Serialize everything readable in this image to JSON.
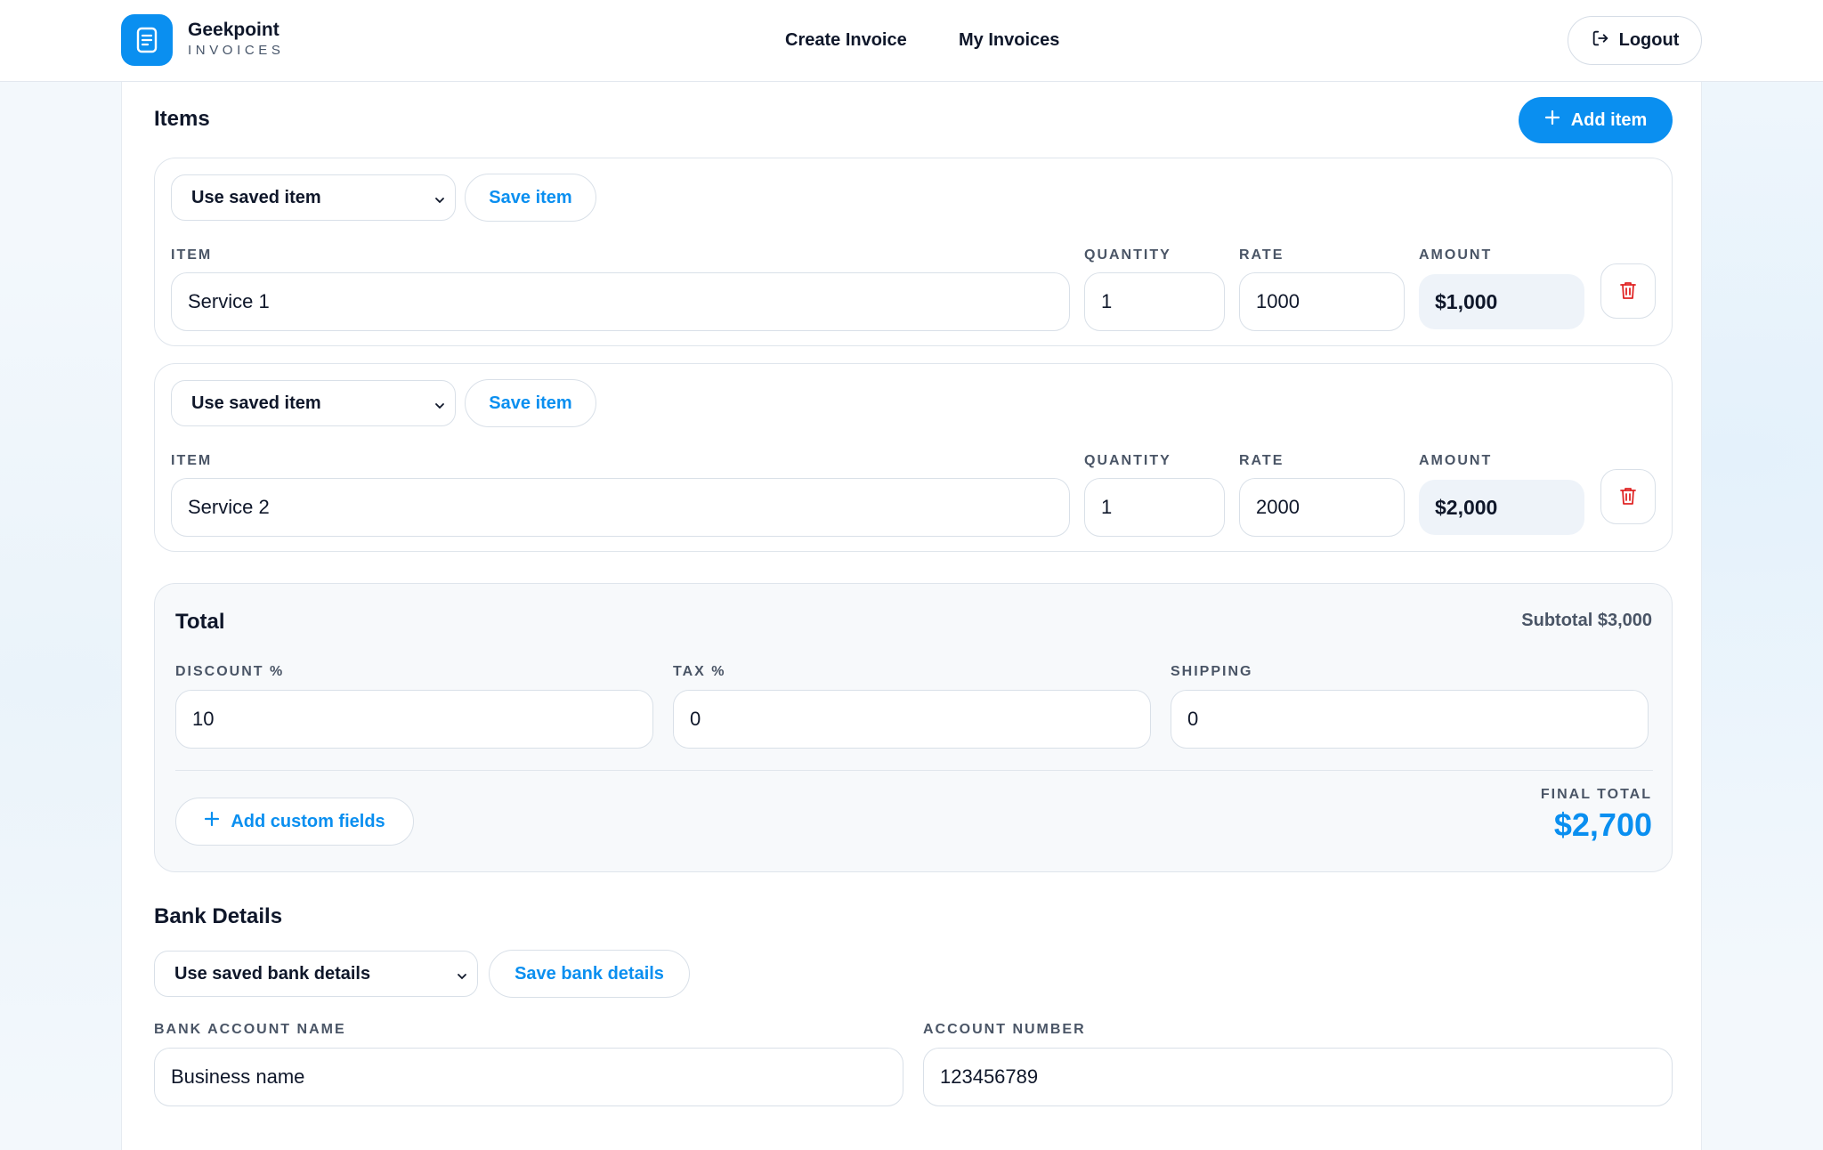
{
  "brand": {
    "name": "Geekpoint",
    "subtitle": "INVOICES"
  },
  "nav": {
    "create_invoice": "Create Invoice",
    "my_invoices": "My Invoices",
    "logout": "Logout"
  },
  "items_section": {
    "title": "Items",
    "add_item_label": "Add item",
    "select_placeholder": "Use saved item",
    "save_item_label": "Save item",
    "labels": {
      "item": "ITEM",
      "quantity": "QUANTITY",
      "rate": "RATE",
      "amount": "AMOUNT"
    },
    "rows": [
      {
        "item": "Service 1",
        "quantity": "1",
        "rate": "1000",
        "amount": "$1,000"
      },
      {
        "item": "Service 2",
        "quantity": "1",
        "rate": "2000",
        "amount": "$2,000"
      }
    ]
  },
  "totals": {
    "title": "Total",
    "subtotal": "Subtotal $3,000",
    "labels": {
      "discount": "DISCOUNT %",
      "tax": "TAX %",
      "shipping": "SHIPPING"
    },
    "discount": "10",
    "tax": "0",
    "shipping": "0",
    "add_custom_fields_label": "Add custom fields",
    "final_total_label": "FINAL TOTAL",
    "final_total": "$2,700"
  },
  "bank": {
    "title": "Bank Details",
    "select_placeholder": "Use saved bank details",
    "save_label": "Save bank details",
    "labels": {
      "account_name": "BANK ACCOUNT NAME",
      "account_number": "ACCOUNT NUMBER"
    },
    "account_name": "Business name",
    "account_number": "123456789"
  },
  "colors": {
    "accent": "#0a8ff0",
    "danger": "#e02424",
    "text": "#0f172a",
    "muted": "#4a5566"
  }
}
